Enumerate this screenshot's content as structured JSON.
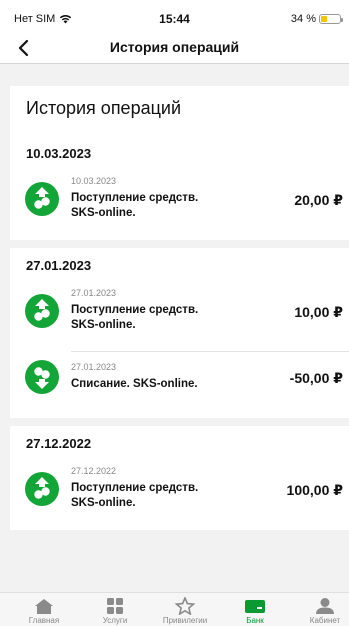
{
  "status_bar": {
    "carrier": "Нет SIM",
    "time": "15:44",
    "battery": "34 %",
    "battery_level": 0.34
  },
  "header": {
    "title": "История операций"
  },
  "card": {
    "title": "История операций"
  },
  "groups": [
    {
      "date": "10.03.2023",
      "items": [
        {
          "date": "10.03.2023",
          "desc": "Поступление средств. SKS-online.",
          "amount": "20,00 ₽",
          "direction": "in"
        }
      ]
    },
    {
      "date": "27.01.2023",
      "items": [
        {
          "date": "27.01.2023",
          "desc": "Поступление средств. SKS-online.",
          "amount": "10,00 ₽",
          "direction": "in"
        },
        {
          "date": "27.01.2023",
          "desc": "Списание. SKS-online.",
          "amount": "-50,00 ₽",
          "direction": "out"
        }
      ]
    },
    {
      "date": "27.12.2022",
      "items": [
        {
          "date": "27.12.2022",
          "desc": "Поступление средств. SKS-online.",
          "amount": "100,00 ₽",
          "direction": "in"
        }
      ]
    }
  ],
  "tabs": [
    {
      "label": "Главная",
      "icon": "home-icon",
      "active": false
    },
    {
      "label": "Услуги",
      "icon": "grid-icon",
      "active": false
    },
    {
      "label": "Привилегии",
      "icon": "star-icon",
      "active": false
    },
    {
      "label": "Банк",
      "icon": "card-icon",
      "active": true
    },
    {
      "label": "Кабинет",
      "icon": "person-icon",
      "active": false
    }
  ],
  "colors": {
    "accent": "#0b9a32",
    "icon_green": "#13a538"
  }
}
